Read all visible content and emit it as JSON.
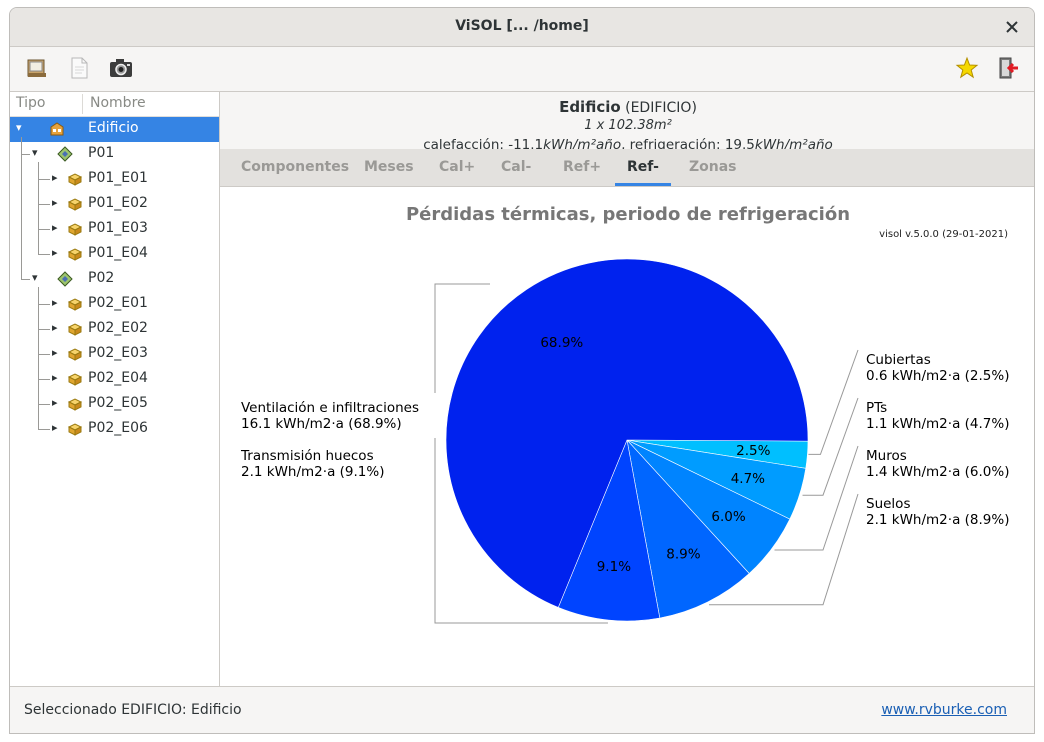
{
  "window": {
    "title": "ViSOL [... /home]"
  },
  "toolbar": {
    "buttons": [
      {
        "name": "open-icon"
      },
      {
        "name": "document-icon"
      },
      {
        "name": "camera-icon"
      },
      {
        "name": "star-icon"
      },
      {
        "name": "exit-icon"
      }
    ]
  },
  "tree": {
    "header_tipo": "Tipo",
    "header_nombre": "Nombre",
    "items": [
      {
        "label": "Edificio",
        "level": 0,
        "kind": "building",
        "expanded": true,
        "selected": true
      },
      {
        "label": "P01",
        "level": 1,
        "kind": "floor",
        "expanded": true
      },
      {
        "label": "P01_E01",
        "level": 2,
        "kind": "space"
      },
      {
        "label": "P01_E02",
        "level": 2,
        "kind": "space"
      },
      {
        "label": "P01_E03",
        "level": 2,
        "kind": "space"
      },
      {
        "label": "P01_E04",
        "level": 2,
        "kind": "space"
      },
      {
        "label": "P02",
        "level": 1,
        "kind": "floor",
        "expanded": true
      },
      {
        "label": "P02_E01",
        "level": 2,
        "kind": "space"
      },
      {
        "label": "P02_E02",
        "level": 2,
        "kind": "space"
      },
      {
        "label": "P02_E03",
        "level": 2,
        "kind": "space"
      },
      {
        "label": "P02_E04",
        "level": 2,
        "kind": "space"
      },
      {
        "label": "P02_E05",
        "level": 2,
        "kind": "space"
      },
      {
        "label": "P02_E06",
        "level": 2,
        "kind": "space"
      }
    ]
  },
  "info": {
    "name": "Edificio",
    "type": "(EDIFICIO)",
    "area": "1 x 102.38m²",
    "demand_prefix_cal": "calefacción: ",
    "cal_value": "-11.1",
    "cal_unit": "kWh/m²año",
    "demand_prefix_ref": ", refrigeración: ",
    "ref_value": "19.5",
    "ref_unit": "kWh/m²año"
  },
  "tabs": [
    {
      "label": "Componentes",
      "active": false
    },
    {
      "label": "Meses",
      "active": false
    },
    {
      "label": "Cal+",
      "active": false
    },
    {
      "label": "Cal-",
      "active": false
    },
    {
      "label": "Ref+",
      "active": false
    },
    {
      "label": "Ref-",
      "active": true
    },
    {
      "label": "Zonas",
      "active": false
    }
  ],
  "chart_data": {
    "type": "pie",
    "title": "Pérdidas térmicas, periodo de refrigeración",
    "version": "visol v.5.0.0 (29-01-2021)",
    "slices": [
      {
        "name": "Cubiertas",
        "value": 0.6,
        "percent": 2.5,
        "pct_label": "2.5%",
        "label_value": "0.6 kWh/m2·a (2.5%)",
        "color": "#00bfff"
      },
      {
        "name": "PTs",
        "value": 1.1,
        "percent": 4.7,
        "pct_label": "4.7%",
        "label_value": "1.1 kWh/m2·a (4.7%)",
        "color": "#009cff"
      },
      {
        "name": "Muros",
        "value": 1.4,
        "percent": 6.0,
        "pct_label": "6.0%",
        "label_value": "1.4 kWh/m2·a (6.0%)",
        "color": "#0084ff"
      },
      {
        "name": "Suelos",
        "value": 2.1,
        "percent": 8.9,
        "pct_label": "8.9%",
        "label_value": "2.1 kWh/m2·a (8.9%)",
        "color": "#0066ff"
      },
      {
        "name": "Transmisión huecos",
        "value": 2.1,
        "percent": 9.1,
        "pct_label": "9.1%",
        "label_value": "2.1 kWh/m2·a (9.1%)",
        "color": "#0044ff"
      },
      {
        "name": "Ventilación e infiltraciones",
        "value": 16.1,
        "percent": 68.9,
        "pct_label": "68.9%",
        "label_value": "16.1 kWh/m2·a (68.9%)",
        "color": "#0022ee"
      }
    ]
  },
  "status": {
    "text": "Seleccionado EDIFICIO: Edificio",
    "link": "www.rvburke.com"
  }
}
